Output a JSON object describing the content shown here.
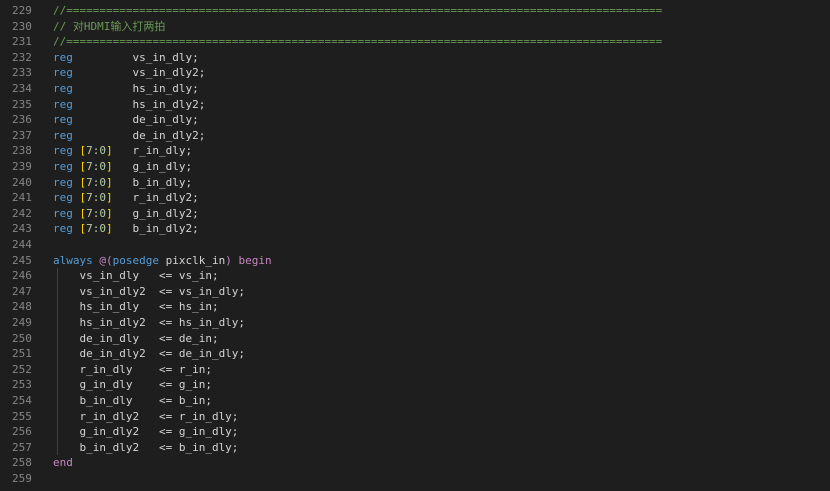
{
  "editor": {
    "lines": [
      {
        "n": "229",
        "tokens": [
          {
            "t": "//==========================================================================================",
            "c": "comment"
          }
        ]
      },
      {
        "n": "230",
        "tokens": [
          {
            "t": "// 对HDMI输入打两拍",
            "c": "comment"
          }
        ]
      },
      {
        "n": "231",
        "tokens": [
          {
            "t": "//==========================================================================================",
            "c": "comment"
          }
        ]
      },
      {
        "n": "232",
        "tokens": [
          {
            "t": "reg",
            "c": "keyword"
          },
          {
            "t": "         vs_in_dly;",
            "c": "text"
          }
        ]
      },
      {
        "n": "233",
        "tokens": [
          {
            "t": "reg",
            "c": "keyword"
          },
          {
            "t": "         vs_in_dly2;",
            "c": "text"
          }
        ]
      },
      {
        "n": "234",
        "tokens": [
          {
            "t": "reg",
            "c": "keyword"
          },
          {
            "t": "         hs_in_dly;",
            "c": "text"
          }
        ]
      },
      {
        "n": "235",
        "tokens": [
          {
            "t": "reg",
            "c": "keyword"
          },
          {
            "t": "         hs_in_dly2;",
            "c": "text"
          }
        ]
      },
      {
        "n": "236",
        "tokens": [
          {
            "t": "reg",
            "c": "keyword"
          },
          {
            "t": "         de_in_dly;",
            "c": "text"
          }
        ]
      },
      {
        "n": "237",
        "tokens": [
          {
            "t": "reg",
            "c": "keyword"
          },
          {
            "t": "         de_in_dly2;",
            "c": "text"
          }
        ]
      },
      {
        "n": "238",
        "tokens": [
          {
            "t": "reg",
            "c": "keyword"
          },
          {
            "t": " ",
            "c": "text"
          },
          {
            "t": "[",
            "c": "bracket"
          },
          {
            "t": "7:0",
            "c": "number"
          },
          {
            "t": "]",
            "c": "bracket"
          },
          {
            "t": "   r_in_dly;",
            "c": "text"
          }
        ]
      },
      {
        "n": "239",
        "tokens": [
          {
            "t": "reg",
            "c": "keyword"
          },
          {
            "t": " ",
            "c": "text"
          },
          {
            "t": "[",
            "c": "bracket"
          },
          {
            "t": "7:0",
            "c": "number"
          },
          {
            "t": "]",
            "c": "bracket"
          },
          {
            "t": "   g_in_dly;",
            "c": "text"
          }
        ]
      },
      {
        "n": "240",
        "tokens": [
          {
            "t": "reg",
            "c": "keyword"
          },
          {
            "t": " ",
            "c": "text"
          },
          {
            "t": "[",
            "c": "bracket"
          },
          {
            "t": "7:0",
            "c": "number"
          },
          {
            "t": "]",
            "c": "bracket"
          },
          {
            "t": "   b_in_dly;",
            "c": "text"
          }
        ]
      },
      {
        "n": "241",
        "tokens": [
          {
            "t": "reg",
            "c": "keyword"
          },
          {
            "t": " ",
            "c": "text"
          },
          {
            "t": "[",
            "c": "bracket"
          },
          {
            "t": "7:0",
            "c": "number"
          },
          {
            "t": "]",
            "c": "bracket"
          },
          {
            "t": "   r_in_dly2;",
            "c": "text"
          }
        ]
      },
      {
        "n": "242",
        "tokens": [
          {
            "t": "reg",
            "c": "keyword"
          },
          {
            "t": " ",
            "c": "text"
          },
          {
            "t": "[",
            "c": "bracket"
          },
          {
            "t": "7:0",
            "c": "number"
          },
          {
            "t": "]",
            "c": "bracket"
          },
          {
            "t": "   g_in_dly2;",
            "c": "text"
          }
        ]
      },
      {
        "n": "243",
        "tokens": [
          {
            "t": "reg",
            "c": "keyword"
          },
          {
            "t": " ",
            "c": "text"
          },
          {
            "t": "[",
            "c": "bracket"
          },
          {
            "t": "7:0",
            "c": "number"
          },
          {
            "t": "]",
            "c": "bracket"
          },
          {
            "t": "   b_in_dly2;",
            "c": "text"
          }
        ]
      },
      {
        "n": "244",
        "tokens": []
      },
      {
        "n": "245",
        "tokens": [
          {
            "t": "always",
            "c": "keyword"
          },
          {
            "t": " ",
            "c": "text"
          },
          {
            "t": "@(",
            "c": "control"
          },
          {
            "t": "posedge",
            "c": "keyword"
          },
          {
            "t": " pixclk_in",
            "c": "text"
          },
          {
            "t": ")",
            "c": "control"
          },
          {
            "t": " ",
            "c": "text"
          },
          {
            "t": "begin",
            "c": "control"
          }
        ]
      },
      {
        "n": "246",
        "tokens": [
          {
            "t": "    vs_in_dly   <= vs_in;",
            "c": "text"
          }
        ]
      },
      {
        "n": "247",
        "tokens": [
          {
            "t": "    vs_in_dly2  <= vs_in_dly;",
            "c": "text"
          }
        ]
      },
      {
        "n": "248",
        "tokens": [
          {
            "t": "    hs_in_dly   <= hs_in;",
            "c": "text"
          }
        ]
      },
      {
        "n": "249",
        "tokens": [
          {
            "t": "    hs_in_dly2  <= hs_in_dly;",
            "c": "text"
          }
        ]
      },
      {
        "n": "250",
        "tokens": [
          {
            "t": "    de_in_dly   <= de_in;",
            "c": "text"
          }
        ]
      },
      {
        "n": "251",
        "tokens": [
          {
            "t": "    de_in_dly2  <= de_in_dly;",
            "c": "text"
          }
        ]
      },
      {
        "n": "252",
        "tokens": [
          {
            "t": "    r_in_dly    <= r_in;",
            "c": "text"
          }
        ]
      },
      {
        "n": "253",
        "tokens": [
          {
            "t": "    g_in_dly    <= g_in;",
            "c": "text"
          }
        ]
      },
      {
        "n": "254",
        "tokens": [
          {
            "t": "    b_in_dly    <= b_in;",
            "c": "text"
          }
        ]
      },
      {
        "n": "255",
        "tokens": [
          {
            "t": "    r_in_dly2   <= r_in_dly;",
            "c": "text"
          }
        ]
      },
      {
        "n": "256",
        "tokens": [
          {
            "t": "    g_in_dly2   <= g_in_dly;",
            "c": "text"
          }
        ]
      },
      {
        "n": "257",
        "tokens": [
          {
            "t": "    b_in_dly2   <= b_in_dly;",
            "c": "text"
          }
        ]
      },
      {
        "n": "258",
        "tokens": [
          {
            "t": "end",
            "c": "control"
          }
        ]
      },
      {
        "n": "259",
        "tokens": []
      }
    ]
  },
  "colors": {
    "background": "#1e1e1e",
    "line_number": "#858585",
    "comment": "#6a9955",
    "keyword": "#569cd6",
    "control": "#c586c0",
    "number": "#b5cea8",
    "bracket": "#ffd700",
    "text": "#d4d4d4"
  }
}
